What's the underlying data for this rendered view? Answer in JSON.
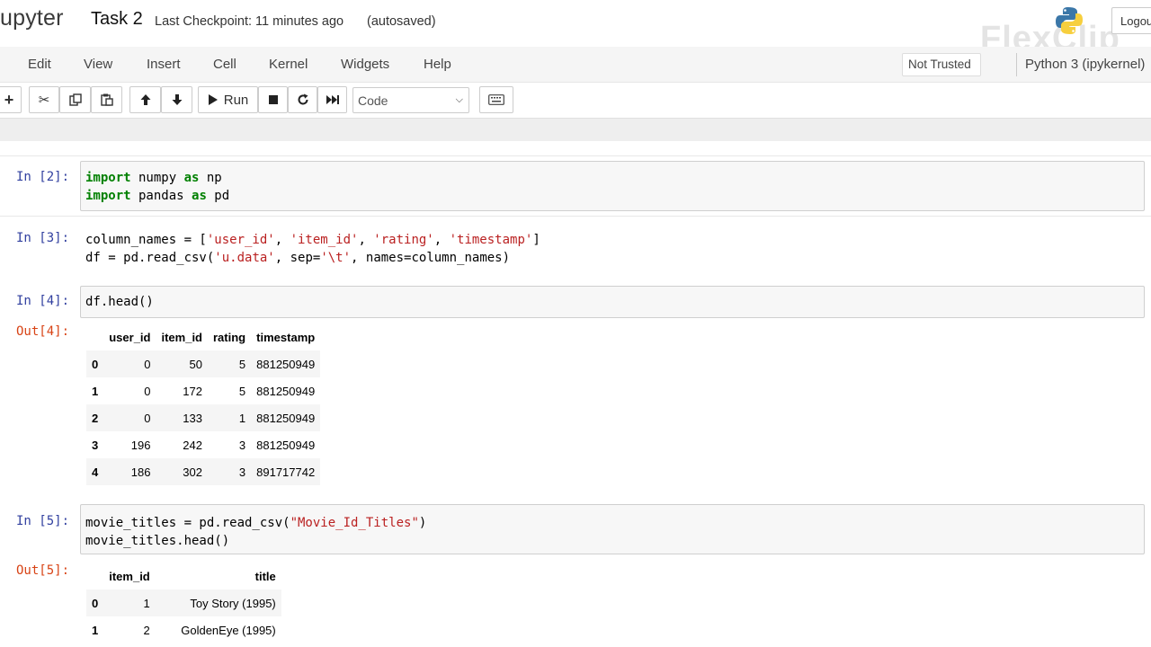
{
  "header": {
    "logo_text": "upyter",
    "notebook_name": "Task 2",
    "checkpoint": "Last Checkpoint: 11 minutes ago",
    "autosave": "(autosaved)",
    "watermark": "FlexClip",
    "logout": "Logout"
  },
  "menu": {
    "items": [
      "Edit",
      "View",
      "Insert",
      "Cell",
      "Kernel",
      "Widgets",
      "Help"
    ],
    "trust": "Not Trusted",
    "kernel": "Python 3 (ipykernel)"
  },
  "toolbar": {
    "run_label": "Run",
    "cell_type": "Code",
    "icons": [
      "plus-icon",
      "cut-icon",
      "copy-icon",
      "paste-icon",
      "arrow-up-icon",
      "arrow-down-icon",
      "run-icon",
      "stop-icon",
      "restart-icon",
      "fast-forward-icon",
      "keyboard-icon"
    ]
  },
  "cells": [
    {
      "prompt": "In [2]:",
      "code": [
        [
          [
            "kw",
            "import"
          ],
          [
            "txt",
            " numpy "
          ],
          [
            "kw",
            "as"
          ],
          [
            "txt",
            " np"
          ]
        ],
        [
          [
            "kw",
            "import"
          ],
          [
            "txt",
            " pandas "
          ],
          [
            "kw",
            "as"
          ],
          [
            "txt",
            " pd"
          ]
        ]
      ]
    },
    {
      "prompt": "In [3]:",
      "code": [
        [
          [
            "txt",
            "column_names = ["
          ],
          [
            "str",
            "'user_id'"
          ],
          [
            "txt",
            ", "
          ],
          [
            "str",
            "'item_id'"
          ],
          [
            "txt",
            ", "
          ],
          [
            "str",
            "'rating'"
          ],
          [
            "txt",
            ", "
          ],
          [
            "str",
            "'timestamp'"
          ],
          [
            "txt",
            "]"
          ]
        ],
        [
          [
            "txt",
            "df = pd.read_csv("
          ],
          [
            "str",
            "'u.data'"
          ],
          [
            "txt",
            ", sep="
          ],
          [
            "str",
            "'\\t'"
          ],
          [
            "txt",
            ", names=column_names)"
          ]
        ]
      ]
    },
    {
      "prompt": "In [4]:",
      "code": [
        [
          [
            "txt",
            "df.head()"
          ]
        ]
      ],
      "out_prompt": "Out[4]:",
      "table": {
        "columns": [
          "",
          "user_id",
          "item_id",
          "rating",
          "timestamp"
        ],
        "rows": [
          [
            "0",
            "0",
            "50",
            "5",
            "881250949"
          ],
          [
            "1",
            "0",
            "172",
            "5",
            "881250949"
          ],
          [
            "2",
            "0",
            "133",
            "1",
            "881250949"
          ],
          [
            "3",
            "196",
            "242",
            "3",
            "881250949"
          ],
          [
            "4",
            "186",
            "302",
            "3",
            "891717742"
          ]
        ]
      }
    },
    {
      "prompt": "In [5]:",
      "code": [
        [
          [
            "txt",
            "movie_titles = pd.read_csv("
          ],
          [
            "str",
            "\"Movie_Id_Titles\""
          ],
          [
            "txt",
            ")"
          ]
        ],
        [
          [
            "txt",
            "movie_titles.head()"
          ]
        ]
      ],
      "out_prompt": "Out[5]:",
      "table": {
        "columns": [
          "",
          "item_id",
          "title"
        ],
        "rows": [
          [
            "0",
            "1",
            "Toy Story (1995)"
          ],
          [
            "1",
            "2",
            "GoldenEye (1995)"
          ]
        ]
      }
    }
  ]
}
